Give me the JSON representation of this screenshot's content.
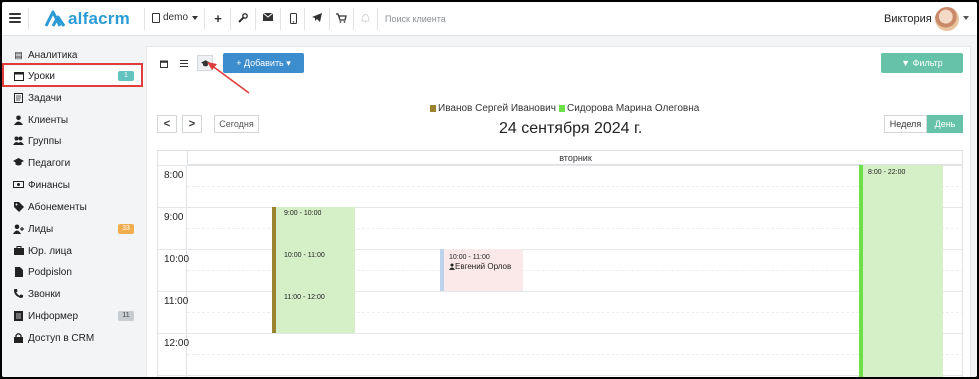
{
  "colors": {
    "brand": "#2b9bd6",
    "primary_button": "#3c8dce",
    "filter_button": "#66c2a8",
    "active_highlight": "#e03c3c",
    "teacher1": "#9b8430",
    "teacher2": "#6ee04a",
    "slot_bg": "#d5efc7",
    "lesson_bg": "#fbe9e9",
    "lesson_accent": "#bcd3ee",
    "badge_info": "#62c3bf",
    "badge_warning": "#f0ad4e",
    "badge_muted": "#c7ccd1"
  },
  "topbar": {
    "logo_text": "alfacrm",
    "branch": "demo",
    "search_placeholder": "Поиск клиента",
    "user_name": "Виктория",
    "icons": [
      "menu-icon",
      "plus-icon",
      "wrench-icon",
      "envelope-icon",
      "mobile-icon",
      "telegram-icon",
      "cart-icon",
      "bell-icon"
    ]
  },
  "sidebar": {
    "items": [
      {
        "label": "Аналитика",
        "icon": "analytics-icon"
      },
      {
        "label": "Уроки",
        "icon": "calendar-icon",
        "badge": "1",
        "active": true
      },
      {
        "label": "Задачи",
        "icon": "tasks-icon"
      },
      {
        "label": "Клиенты",
        "icon": "user-icon"
      },
      {
        "label": "Группы",
        "icon": "users-icon"
      },
      {
        "label": "Педагоги",
        "icon": "graduation-cap-icon"
      },
      {
        "label": "Финансы",
        "icon": "money-icon"
      },
      {
        "label": "Абонементы",
        "icon": "tag-icon"
      },
      {
        "label": "Лиды",
        "icon": "user-plus-icon",
        "badge": "33"
      },
      {
        "label": "Юр. лица",
        "icon": "briefcase-icon"
      },
      {
        "label": "Podpislon",
        "icon": "file-icon"
      },
      {
        "label": "Звонки",
        "icon": "phone-icon"
      },
      {
        "label": "Информер",
        "icon": "archive-icon",
        "badge": "11"
      },
      {
        "label": "Доступ в CRM",
        "icon": "lock-icon"
      }
    ]
  },
  "toolbar": {
    "add_label": "+ Добавить ▾",
    "filter_label": "▼ Фильтр"
  },
  "calendar": {
    "legend": [
      {
        "name": "Иванов Сергей Иванович"
      },
      {
        "name": "Сидорова Марина Олеговна"
      }
    ],
    "title": "24 сентября 2024 г.",
    "today_label": "Сегодня",
    "prev_label": "<",
    "next_label": ">",
    "week_label": "Неделя",
    "day_label": "День",
    "day_header": "вторник",
    "hours": [
      "8:00",
      "9:00",
      "10:00",
      "11:00",
      "12:00"
    ],
    "events": [
      {
        "time": "8:00 - 22:00"
      },
      {
        "time": "9:00 - 10:00"
      },
      {
        "time": "10:00 - 11:00"
      },
      {
        "time": "11:00 - 12:00"
      },
      {
        "time": "10:00 - 11:00",
        "person": "Евгений Орлов"
      }
    ]
  }
}
